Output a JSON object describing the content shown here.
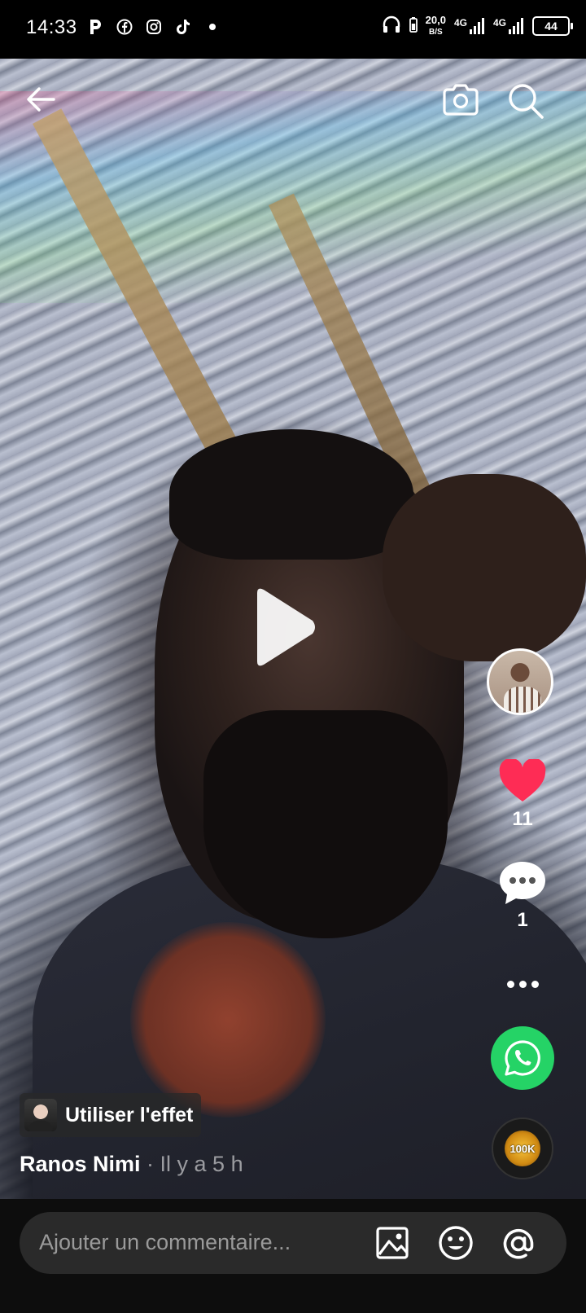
{
  "status_bar": {
    "time": "14:33",
    "app_icons": [
      "p-icon",
      "facebook-icon",
      "instagram-icon",
      "tiktok-icon",
      "dot-icon"
    ],
    "speed_value": "20,0",
    "speed_unit": "B/S",
    "network_1": "4G",
    "network_2": "4G",
    "battery": "44"
  },
  "top_bar": {
    "back_icon": "arrow-left-icon",
    "camera_icon": "camera-icon",
    "search_icon": "search-icon"
  },
  "video": {
    "play_icon": "play-icon"
  },
  "right_rail": {
    "like_count": "11",
    "comment_count": "1",
    "like_color": "#fe2c55",
    "whatsapp_color": "#25d366",
    "sound_badge": "100K"
  },
  "effect": {
    "label": "Utiliser l'effet"
  },
  "post": {
    "author": "Ranos Nimi",
    "time": "· Il y a 5 h"
  },
  "comment_bar": {
    "placeholder": "Ajouter un commentaire..."
  }
}
